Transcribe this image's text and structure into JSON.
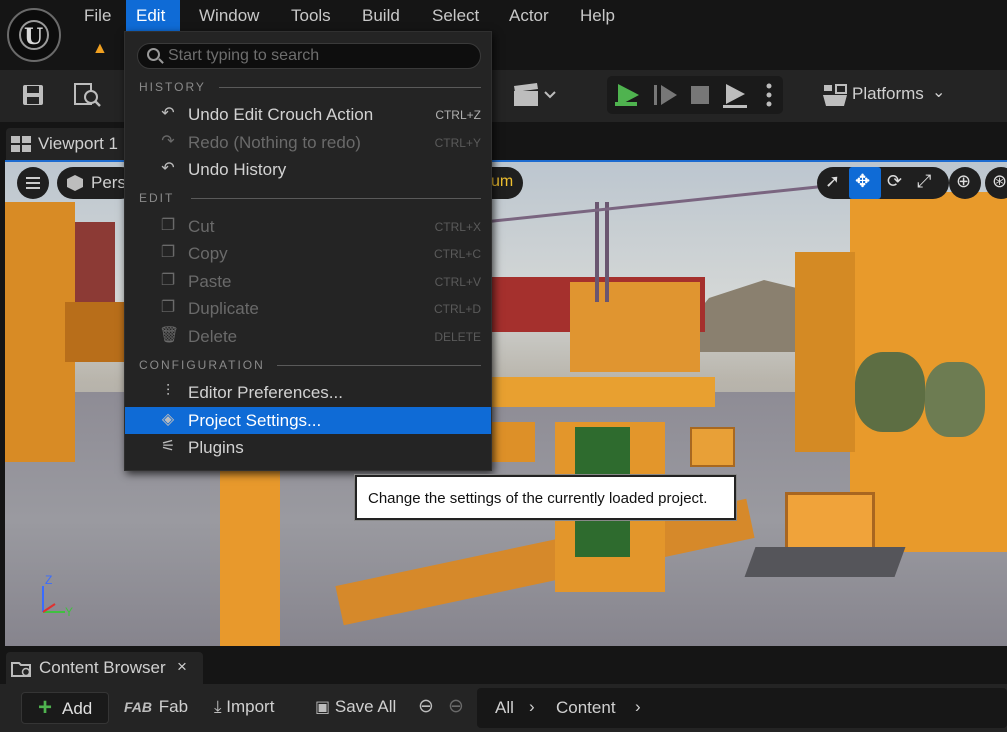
{
  "menubar": {
    "items": [
      "File",
      "Edit",
      "Window",
      "Tools",
      "Build",
      "Select",
      "Actor",
      "Help"
    ],
    "active": "Edit"
  },
  "toolbar": {
    "platforms_label": "Platforms"
  },
  "viewport": {
    "tab_label": "Viewport 1",
    "perspective_label": "Pers",
    "partial_label": "um"
  },
  "editmenu": {
    "search_placeholder": "Start typing to search",
    "sections": {
      "history": "HISTORY",
      "edit": "EDIT",
      "configuration": "CONFIGURATION"
    },
    "items": [
      {
        "label": "Undo Edit Crouch Action",
        "shortcut": "CTRL+Z",
        "icon": "undo-icon",
        "enabled": true
      },
      {
        "label": "Redo (Nothing to redo)",
        "shortcut": "CTRL+Y",
        "icon": "redo-icon",
        "enabled": false
      },
      {
        "label": "Undo History",
        "shortcut": "",
        "icon": "undo-history-icon",
        "enabled": true
      },
      {
        "label": "Cut",
        "shortcut": "CTRL+X",
        "icon": "cut-icon",
        "enabled": false
      },
      {
        "label": "Copy",
        "shortcut": "CTRL+C",
        "icon": "copy-icon",
        "enabled": false
      },
      {
        "label": "Paste",
        "shortcut": "CTRL+V",
        "icon": "paste-icon",
        "enabled": false
      },
      {
        "label": "Duplicate",
        "shortcut": "CTRL+D",
        "icon": "duplicate-icon",
        "enabled": false
      },
      {
        "label": "Delete",
        "shortcut": "DELETE",
        "icon": "delete-icon",
        "enabled": false
      },
      {
        "label": "Editor Preferences...",
        "shortcut": "",
        "icon": "sliders-icon",
        "enabled": true
      },
      {
        "label": "Project Settings...",
        "shortcut": "",
        "icon": "project-settings-icon",
        "enabled": true,
        "highlighted": true
      },
      {
        "label": "Plugins",
        "shortcut": "",
        "icon": "plugins-icon",
        "enabled": true
      }
    ]
  },
  "tooltip": {
    "text": "Change the settings of the currently loaded project."
  },
  "content_browser": {
    "tab_label": "Content Browser",
    "close_label": "×",
    "add_label": "Add",
    "fab_label": "Fab",
    "import_label": "Import",
    "save_all_label": "Save All",
    "breadcrumbs": [
      "All",
      "Content"
    ]
  },
  "colors": {
    "accent": "#0f6bd6",
    "panel": "#242424",
    "background": "#151515",
    "play_green": "#4fb34f"
  }
}
